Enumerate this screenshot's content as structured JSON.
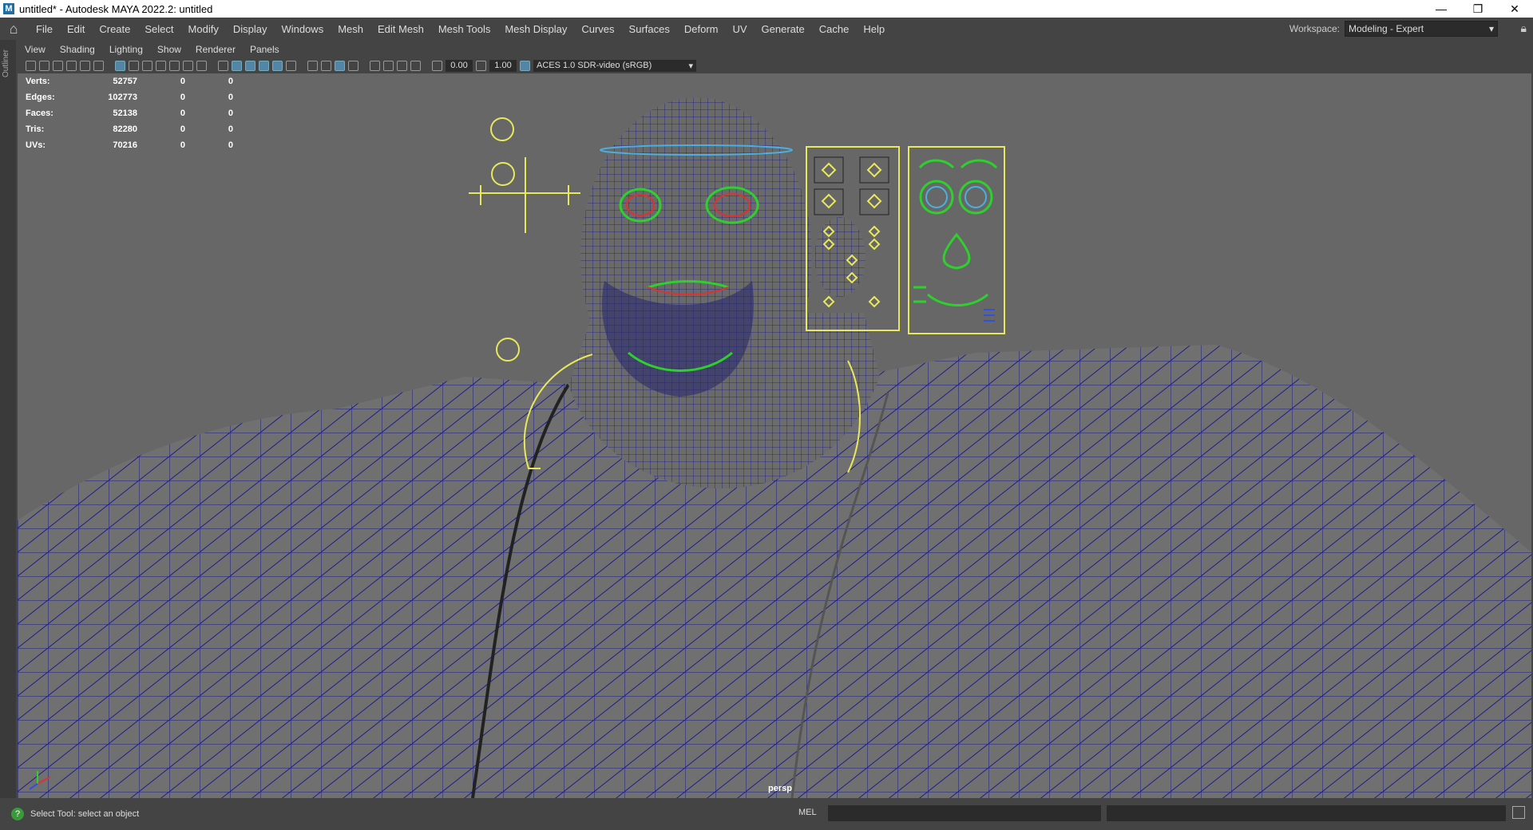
{
  "window": {
    "title": "untitled* - Autodesk MAYA 2022.2: untitled",
    "app_icon": "M",
    "controls": [
      "—",
      "❐",
      "✕"
    ]
  },
  "menu": [
    "File",
    "Edit",
    "Create",
    "Select",
    "Modify",
    "Display",
    "Windows",
    "Mesh",
    "Edit Mesh",
    "Mesh Tools",
    "Mesh Display",
    "Curves",
    "Surfaces",
    "Deform",
    "UV",
    "Generate",
    "Cache",
    "Help"
  ],
  "workspace": {
    "label": "Workspace:",
    "value": "Modeling - Expert"
  },
  "outliner_label": "Outliner",
  "panel_menu": [
    "View",
    "Shading",
    "Lighting",
    "Show",
    "Renderer",
    "Panels"
  ],
  "toolbar": {
    "exposure": "0.00",
    "gamma": "1.00",
    "color_management": "ACES 1.0 SDR-video (sRGB)"
  },
  "hud": {
    "rows": [
      {
        "label": "Verts:",
        "value": "52757",
        "a": "0",
        "b": "0"
      },
      {
        "label": "Edges:",
        "value": "102773",
        "a": "0",
        "b": "0"
      },
      {
        "label": "Faces:",
        "value": "52138",
        "a": "0",
        "b": "0"
      },
      {
        "label": "Tris:",
        "value": "82280",
        "a": "0",
        "b": "0"
      },
      {
        "label": "UVs:",
        "value": "70216",
        "a": "0",
        "b": "0"
      }
    ]
  },
  "camera_label": "persp",
  "status": {
    "help_text": "Select Tool: select an object",
    "mel_label": "MEL"
  },
  "colors": {
    "wire": "#1c1c8c",
    "control": "#e8e85a",
    "face_control": "#2ed02e",
    "accent": "#5285a6"
  }
}
